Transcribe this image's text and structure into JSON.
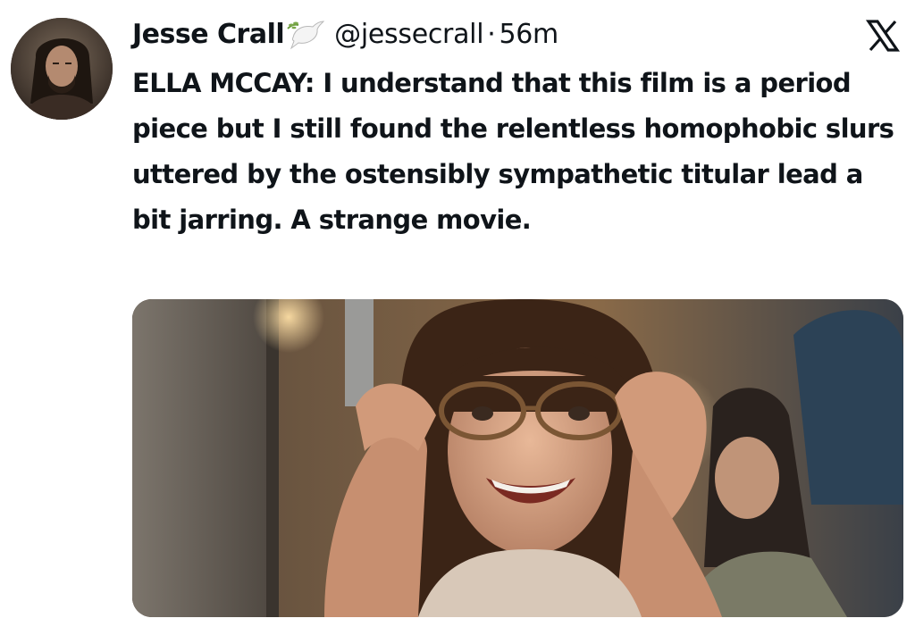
{
  "tweet": {
    "author_name": "Jesse Crall",
    "handle": "@jessecrall",
    "separator": "·",
    "time": "56m",
    "text": "ELLA MCCAY: I understand that this film is a period piece but I still found the relentless homophobic slurs uttered by the ostensibly sympathetic titular lead a bit jarring. A strange movie.",
    "badge_icon": "dove-icon",
    "media_alt": "photo"
  },
  "chrome": {
    "close_icon": "x-logo-icon"
  },
  "colors": {
    "text": "#0f1419",
    "background": "#ffffff"
  }
}
